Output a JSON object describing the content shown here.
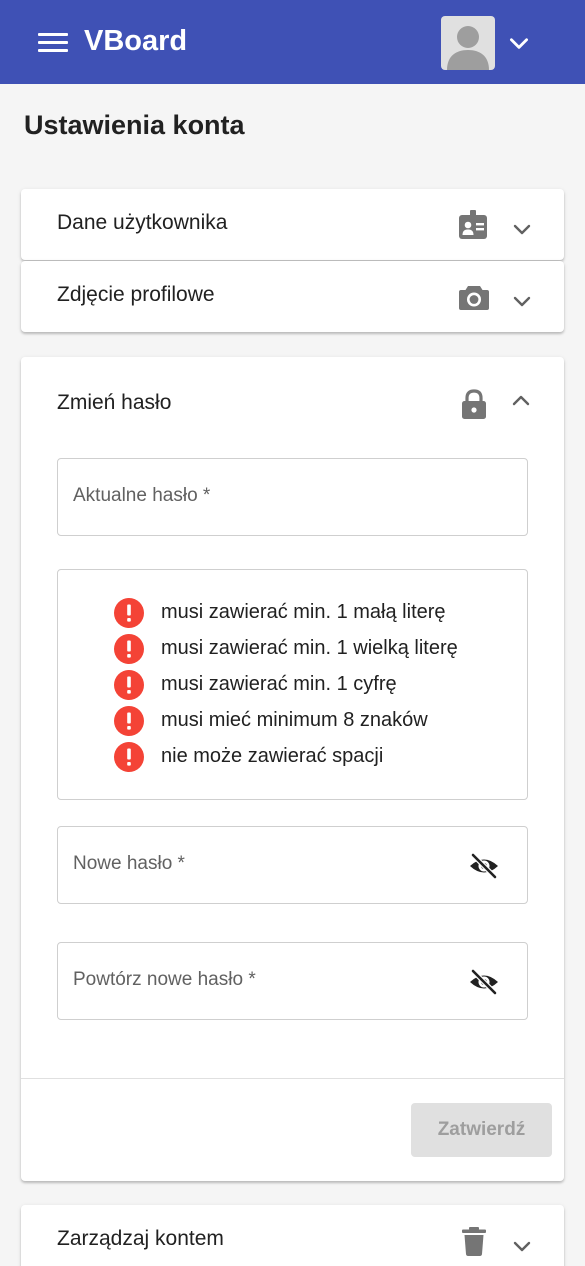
{
  "app": {
    "title": "VBoard"
  },
  "page": {
    "title": "Ustawienia konta"
  },
  "panels": {
    "user_data": {
      "title": "Dane użytkownika",
      "icon": "id-badge-icon",
      "expanded": false
    },
    "profile_photo": {
      "title": "Zdjęcie profilowe",
      "icon": "camera-icon",
      "expanded": false
    },
    "change_password": {
      "title": "Zmień hasło",
      "icon": "lock-icon",
      "expanded": true,
      "current_password_label": "Aktualne hasło *",
      "requirements": [
        "musi zawierać min. 1 małą literę",
        "musi zawierać min. 1 wielką literę",
        "musi zawierać min. 1 cyfrę",
        "musi mieć minimum 8 znaków",
        "nie może zawierać spacji"
      ],
      "new_password_label": "Nowe hasło *",
      "repeat_password_label": "Powtórz nowe hasło *",
      "submit_label": "Zatwierdź",
      "submit_disabled": true
    },
    "manage_account": {
      "title": "Zarządzaj kontem",
      "icon": "trash-icon",
      "expanded": false
    }
  },
  "colors": {
    "primary": "#3f51b5",
    "error": "#f44336",
    "icon_gray": "#757575",
    "disabled_bg": "#e0e0e0",
    "disabled_text": "#9e9e9e"
  }
}
